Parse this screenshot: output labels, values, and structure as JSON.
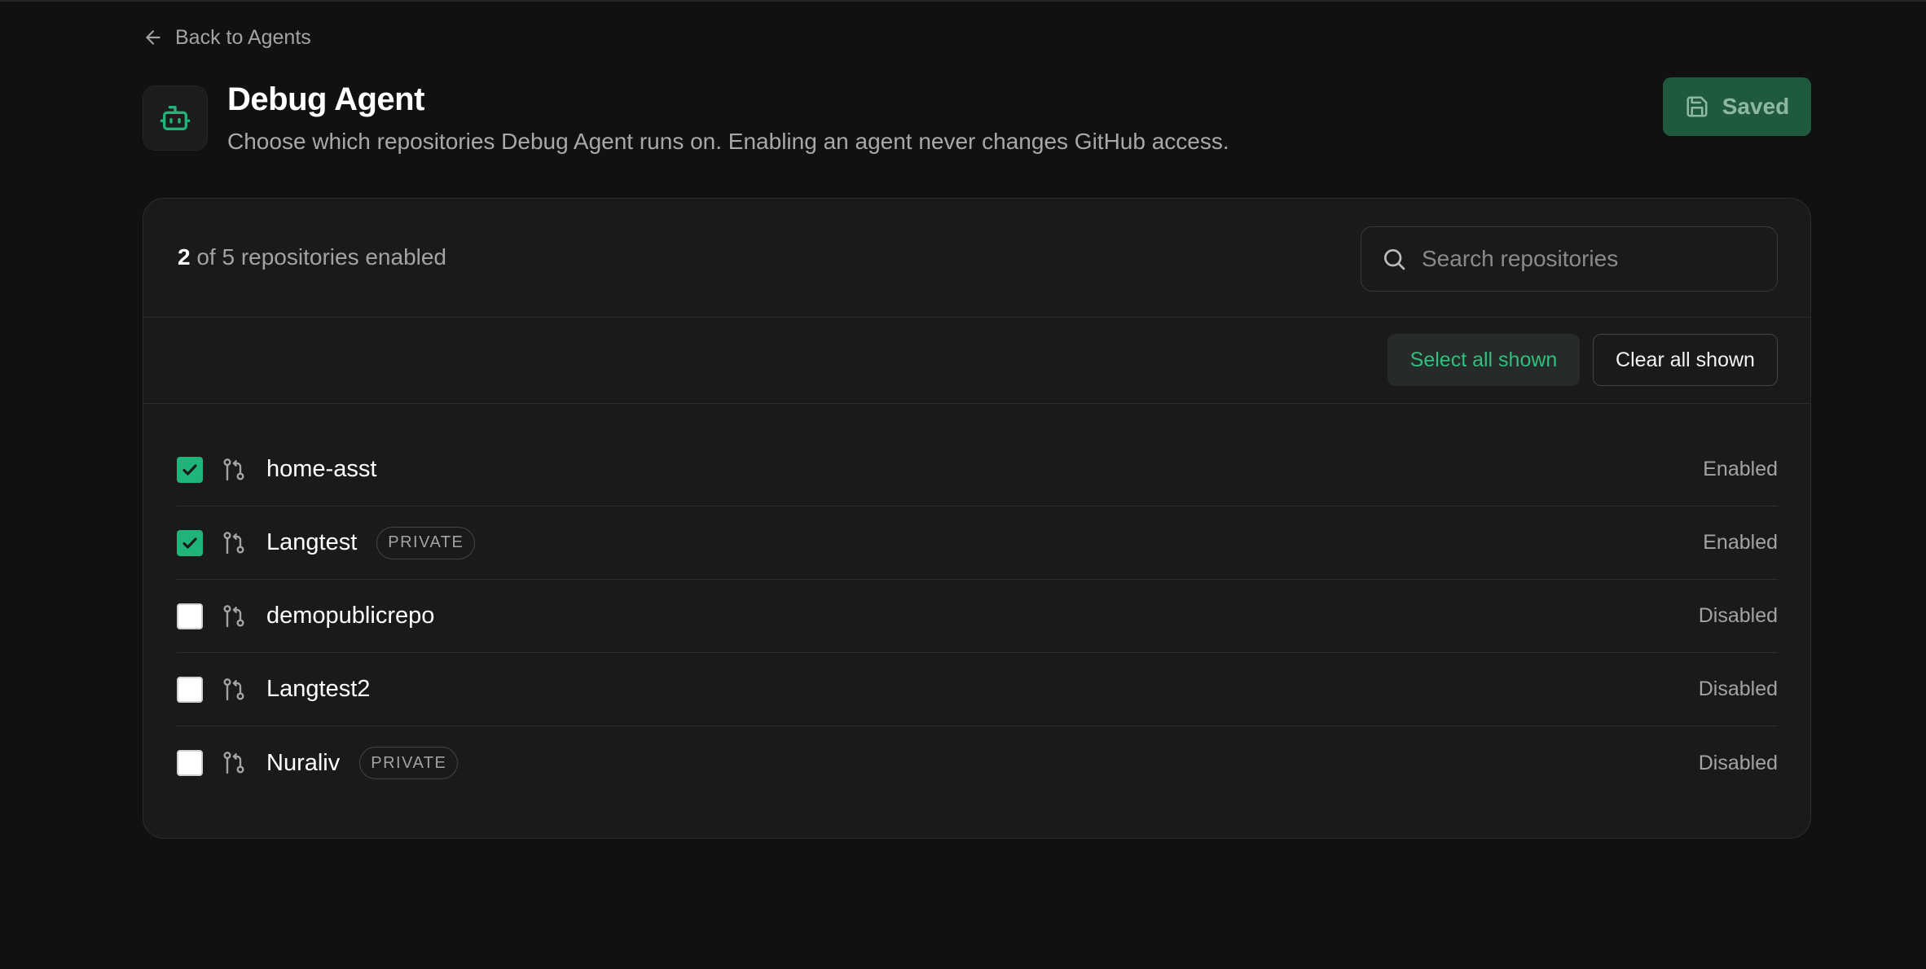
{
  "nav": {
    "back_label": "Back to Agents"
  },
  "header": {
    "title": "Debug Agent",
    "subtitle": "Choose which repositories Debug Agent runs on. Enabling an agent never changes GitHub access.",
    "save_label": "Saved"
  },
  "summary": {
    "enabled": "2",
    "rest": "of 5 repositories enabled"
  },
  "search": {
    "placeholder": "Search repositories"
  },
  "actions": {
    "select_all": "Select all shown",
    "clear_all": "Clear all shown"
  },
  "repos": [
    {
      "name": "home-asst",
      "badge": "",
      "checked": true,
      "status": "Enabled"
    },
    {
      "name": "Langtest",
      "badge": "PRIVATE",
      "checked": true,
      "status": "Enabled"
    },
    {
      "name": "demopublicrepo",
      "badge": "",
      "checked": false,
      "status": "Disabled"
    },
    {
      "name": "Langtest2",
      "badge": "",
      "checked": false,
      "status": "Disabled"
    },
    {
      "name": "Nuraliv",
      "badge": "PRIVATE",
      "checked": false,
      "status": "Disabled"
    }
  ],
  "colors": {
    "accent": "#1fb57a",
    "accent_text": "#2fbf7f",
    "saved_bg": "#1f5a3e",
    "background": "#111111",
    "card": "#1a1a1a"
  },
  "icons": {
    "back": "arrow-left-icon",
    "agent": "robot-icon",
    "save": "floppy-disk-icon",
    "search": "search-icon",
    "repo": "git-pull-request-icon",
    "check": "checkmark-icon"
  }
}
